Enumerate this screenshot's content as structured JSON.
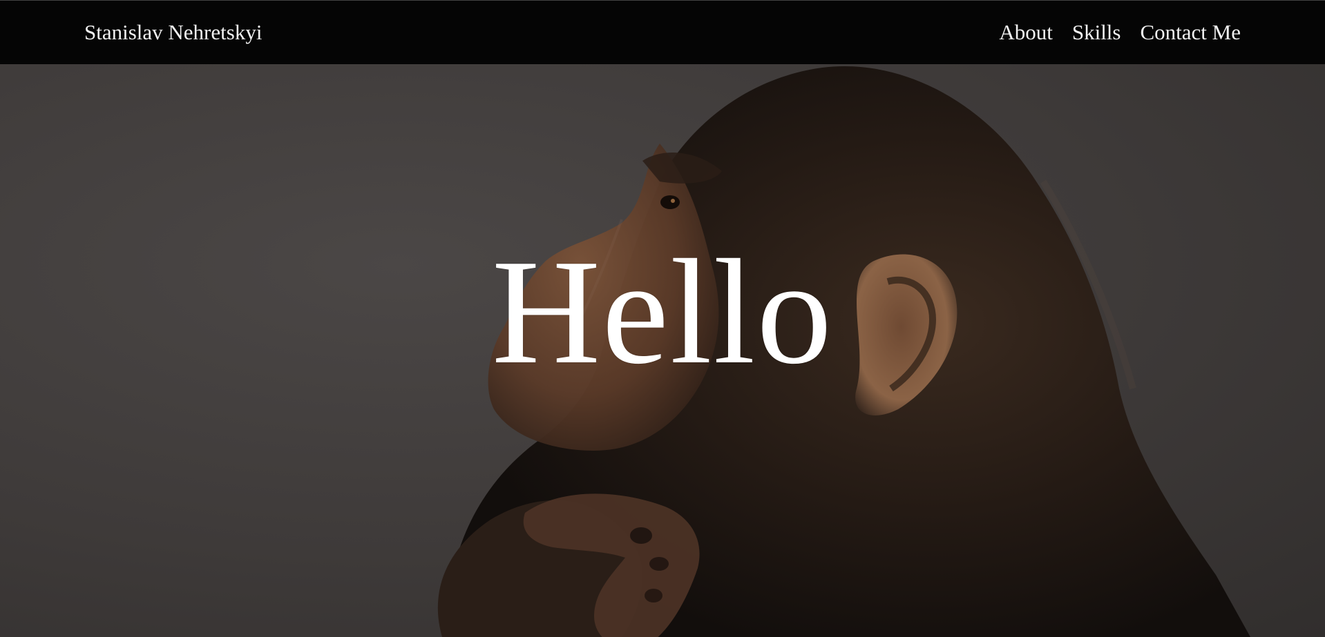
{
  "navbar": {
    "brand": "Stanislav Nehretskyi",
    "links": [
      {
        "label": "About"
      },
      {
        "label": "Skills"
      },
      {
        "label": "Contact Me"
      }
    ]
  },
  "hero": {
    "title": "Hello",
    "background_subject": "chimpanzee-in-thinking-pose",
    "colors": {
      "navbar_bg": "#050505",
      "nav_text": "#f2f2f2",
      "hero_bg": "#3f3b3a",
      "title_text": "#ffffff"
    }
  }
}
